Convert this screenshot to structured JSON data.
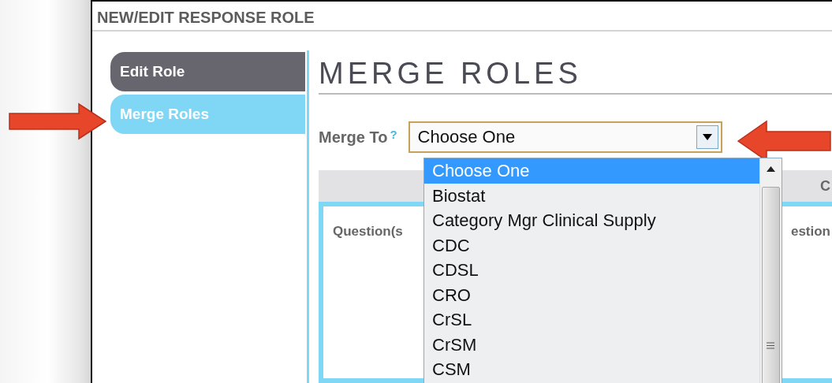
{
  "window": {
    "title": "NEW/EDIT RESPONSE ROLE"
  },
  "sidebar": {
    "items": [
      {
        "label": "Edit Role",
        "selected": false
      },
      {
        "label": "Merge Roles",
        "selected": true
      }
    ]
  },
  "heading": "MERGE ROLES",
  "merge_to": {
    "label": "Merge To",
    "help": "?",
    "value": "Choose One",
    "expanded": true
  },
  "dropdown": {
    "options": [
      {
        "label": "Choose One",
        "selected": true
      },
      {
        "label": "Biostat",
        "selected": false
      },
      {
        "label": "Category Mgr Clinical Supply",
        "selected": false
      },
      {
        "label": "CDC",
        "selected": false
      },
      {
        "label": "CDSL",
        "selected": false
      },
      {
        "label": "CRO",
        "selected": false
      },
      {
        "label": "CrSL",
        "selected": false
      },
      {
        "label": "CrSM",
        "selected": false
      },
      {
        "label": "CSM",
        "selected": false
      }
    ]
  },
  "table": {
    "header_fragment": "C",
    "left_text": "Question(s",
    "right_text": "estion"
  }
}
